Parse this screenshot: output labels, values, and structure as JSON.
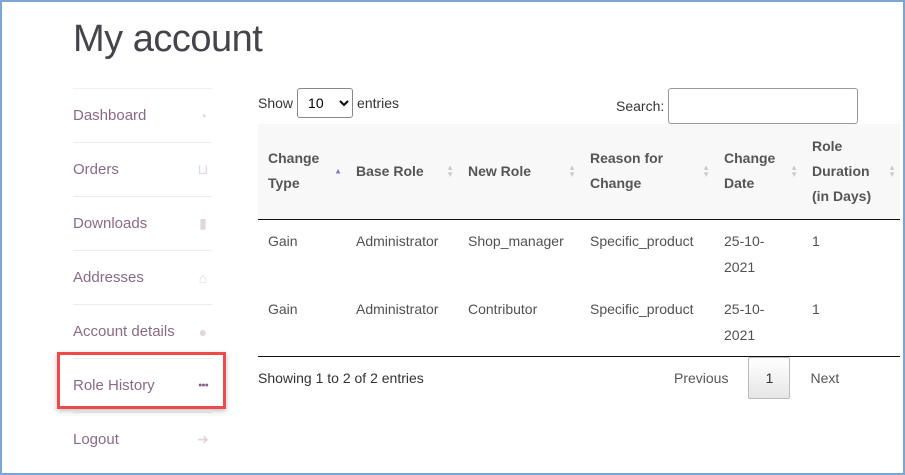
{
  "page_title": "My account",
  "nav": [
    {
      "label": "Dashboard",
      "icon": "dashboard-icon",
      "glyph": "◔"
    },
    {
      "label": "Orders",
      "icon": "basket-icon",
      "glyph": "⊔"
    },
    {
      "label": "Downloads",
      "icon": "file-archive-icon",
      "glyph": "▮"
    },
    {
      "label": "Addresses",
      "icon": "home-icon",
      "glyph": "⌂"
    },
    {
      "label": "Account details",
      "icon": "user-icon",
      "glyph": "●"
    },
    {
      "label": "Role History",
      "icon": "users-icon",
      "glyph": "●●●"
    },
    {
      "label": "Logout",
      "icon": "sign-out-icon",
      "glyph": "➜"
    }
  ],
  "active_nav": "Role History",
  "length": {
    "show": "Show",
    "value": "10",
    "entries": "entries"
  },
  "search": {
    "label": "Search:",
    "value": ""
  },
  "table": {
    "headers": [
      "Change Type",
      "Base Role",
      "New Role",
      "Reason for Change",
      "Change Date",
      "Role Duration (in Days)"
    ],
    "rows": [
      [
        "Gain",
        "Administrator",
        "Shop_manager",
        "Specific_product",
        "25-10-2021",
        "1"
      ],
      [
        "Gain",
        "Administrator",
        "Contributor",
        "Specific_product",
        "25-10-2021",
        "1"
      ]
    ]
  },
  "info": "Showing 1 to 2 of 2 entries",
  "pager": {
    "previous": "Previous",
    "page": "1",
    "next": "Next"
  }
}
